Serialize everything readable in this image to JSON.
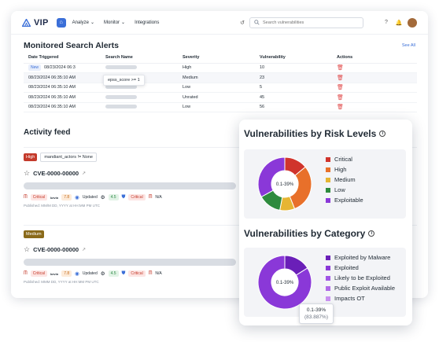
{
  "nav": {
    "logo": "VIP",
    "items": [
      {
        "label": "Analyze",
        "has_dropdown": true
      },
      {
        "label": "Monitor",
        "has_dropdown": true
      },
      {
        "label": "Integrations",
        "has_dropdown": false
      }
    ],
    "search_placeholder": "Search vulnerabilities"
  },
  "alerts": {
    "title": "Monitored Search Alerts",
    "see_all": "See All",
    "columns": [
      "Date Triggered",
      "Search Name",
      "Severity",
      "Vulnerability",
      "Actions"
    ],
    "rows": [
      {
        "badge": "New",
        "date": "08/23/2024 06:3",
        "severity": "High",
        "vulnerability": "10"
      },
      {
        "badge": "",
        "date": "08/23/2024 06:35:10 AM",
        "severity": "Medium",
        "vulnerability": "23"
      },
      {
        "badge": "",
        "date": "08/23/2024 06:35:10 AM",
        "severity": "Low",
        "vulnerability": "5"
      },
      {
        "badge": "",
        "date": "08/23/2024 06:35:10 AM",
        "severity": "Unrated",
        "vulnerability": "45"
      },
      {
        "badge": "",
        "date": "08/23/2024 06:35:10 AM",
        "severity": "Low",
        "vulnerability": "56"
      }
    ],
    "tooltip": "epss_score >= 1"
  },
  "activity": {
    "title": "Activity feed",
    "cards": [
      {
        "severity": "High",
        "filter": "mandiant_actors != None",
        "cve": "CVE-0000-00000",
        "badges": {
          "critical1": "Critical",
          "kev": "kevin",
          "score": "7.8",
          "updated": "Updated",
          "epss": "4.5",
          "critical2": "Critical",
          "na": "N/A"
        },
        "published": "Published: MM/M DD, YYYY at HH:MM PM UTC"
      },
      {
        "severity": "Medium",
        "filter": "",
        "cve": "CVE-0000-00000",
        "badges": {
          "critical1": "Critical",
          "kev": "kevin",
          "score": "7.8",
          "updated": "Updated",
          "epss": "4.5",
          "critical2": "Critical",
          "na": "N/A"
        },
        "published": "Published: MMM DD, YYYY at HH:MM PM UTC"
      }
    ]
  },
  "panel": {
    "risk_title": "Vulnerabilities by Risk Levels",
    "category_title": "Vulnerabilities by Category",
    "tooltip_value": "0.1-39%",
    "tooltip_sub": "(83.887%)",
    "colors": {
      "critical": "#d0342c",
      "high": "#e8702a",
      "medium": "#e6b533",
      "low": "#2e8b3e",
      "exploitable": "#8a38d8",
      "exploited_by_malware": "#6a1fb8",
      "exploited": "#8a38d8",
      "likely": "#a055e6",
      "public_exploit": "#b06ae8",
      "impacts_ot": "#c890ef"
    }
  },
  "chart_data": [
    {
      "type": "pie",
      "title": "Vulnerabilities by Risk Levels",
      "center_label": "0.1-39%",
      "categories": [
        "Critical",
        "High",
        "Medium",
        "Low",
        "Exploitable"
      ],
      "values": [
        14,
        30,
        9,
        14,
        33
      ]
    },
    {
      "type": "pie",
      "title": "Vulnerabilities by Category",
      "center_label": "0.1-39%",
      "categories": [
        "Exploited by Malware",
        "Exploited",
        "Likely to be Exploited",
        "Public Exploit Available",
        "Impacts OT"
      ],
      "values": [
        16.113,
        83.887,
        0,
        0,
        0
      ]
    }
  ]
}
